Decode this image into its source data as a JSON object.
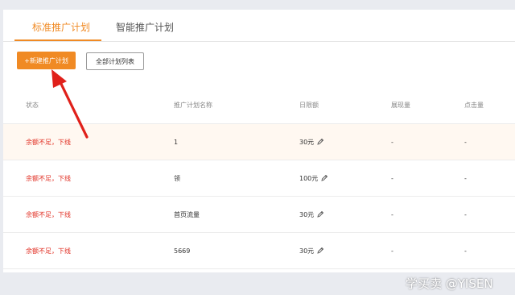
{
  "tabs": [
    {
      "label": "标准推广计划",
      "active": true
    },
    {
      "label": "智能推广计划",
      "active": false
    }
  ],
  "toolbar": {
    "new_plan_label": "+新建推广计划",
    "all_plans_label": "全部计划列表"
  },
  "table": {
    "columns": [
      "状态",
      "推广计划名称",
      "日限额",
      "展现量",
      "点击量"
    ],
    "rows": [
      {
        "status": "余额不足，下线",
        "name": "1",
        "budget": "30元",
        "impressions": "-",
        "clicks": "-"
      },
      {
        "status": "余额不足，下线",
        "name": "领",
        "budget": "100元",
        "impressions": "-",
        "clicks": "-"
      },
      {
        "status": "余额不足，下线",
        "name": "首页流量",
        "budget": "30元",
        "impressions": "-",
        "clicks": "-"
      },
      {
        "status": "余额不足，下线",
        "name": "5669",
        "budget": "30元",
        "impressions": "-",
        "clicks": "-"
      }
    ]
  },
  "watermark": "学买卖 @YISEN",
  "colors": {
    "accent": "#f08a24",
    "status_red": "#e02a1e",
    "arrow_red": "#e0201a"
  },
  "icons": [
    "pencil-icon",
    "arrow-annotation"
  ]
}
